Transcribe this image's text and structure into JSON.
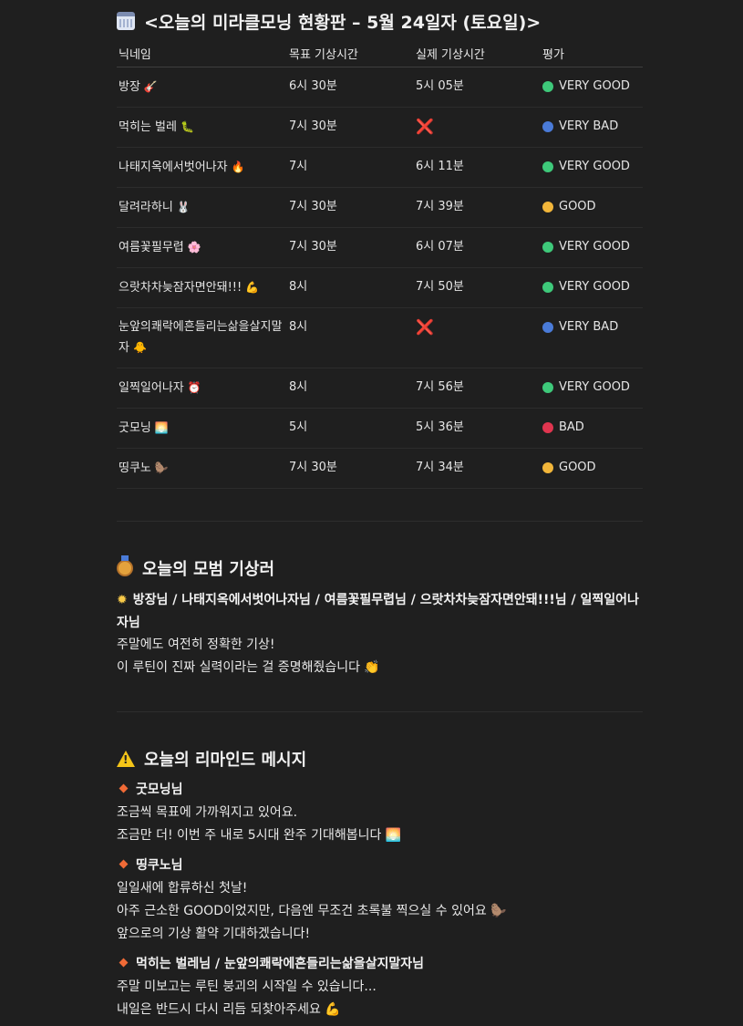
{
  "title": "<오늘의 미라클모닝 현황판 – 5월 24일자 (토요일)>",
  "table": {
    "headers": [
      "닉네임",
      "목표 기상시간",
      "실제 기상시간",
      "평가"
    ],
    "rows": [
      {
        "nick": "방장",
        "emoji": "🎸",
        "goal": "6시 30분",
        "actual": "5시 05분",
        "eval": "VERY GOOD",
        "dot": "#3ec97a"
      },
      {
        "nick": "먹히는 벌레",
        "emoji": "🐛",
        "goal": "7시 30분",
        "actual": "❌",
        "eval": "VERY BAD",
        "dot": "#4a7bd8"
      },
      {
        "nick": "나태지옥에서벗어나자",
        "emoji": "🔥",
        "goal": "7시",
        "actual": "6시 11분",
        "eval": "VERY GOOD",
        "dot": "#3ec97a"
      },
      {
        "nick": "달려라하니",
        "emoji": "🐰",
        "goal": "7시 30분",
        "actual": "7시 39분",
        "eval": "GOOD",
        "dot": "#f2b63a"
      },
      {
        "nick": "여름꽃필무렵",
        "emoji": "🌸",
        "goal": "7시 30분",
        "actual": "6시 07분",
        "eval": "VERY GOOD",
        "dot": "#3ec97a"
      },
      {
        "nick": "으랏차차늦잠자면안돼!!!",
        "emoji": "💪",
        "goal": "8시",
        "actual": "7시 50분",
        "eval": "VERY GOOD",
        "dot": "#3ec97a"
      },
      {
        "nick": "눈앞의쾌락에흔들리는삶을살지말자",
        "emoji": "🐥",
        "goal": "8시",
        "actual": "❌",
        "eval": "VERY BAD",
        "dot": "#4a7bd8"
      },
      {
        "nick": "일찍일어나자",
        "emoji": "⏰",
        "goal": "8시",
        "actual": "7시 56분",
        "eval": "VERY GOOD",
        "dot": "#3ec97a"
      },
      {
        "nick": "굿모닝",
        "emoji": "🌅",
        "goal": "5시",
        "actual": "5시 36분",
        "eval": "BAD",
        "dot": "#e0354f"
      },
      {
        "nick": "띵쿠노",
        "emoji": "🦫",
        "goal": "7시 30분",
        "actual": "7시 34분",
        "eval": "GOOD",
        "dot": "#f2b63a"
      }
    ]
  },
  "model": {
    "heading": "오늘의 모범 기상러",
    "icon": "medal-icon",
    "names": "방장님 / 나태지옥에서벗어나자님 / 여름꽃필무렵님 / 으랏차차늦잠자면안돼!!!님 / 일찍일어나자님",
    "line1": "주말에도 여전히 정확한 기상!",
    "line2": "이 루틴이 진짜 실력이라는 걸 증명해줬습니다 👏"
  },
  "reminder": {
    "heading": "오늘의 리마인드 메시지",
    "icon": "warning-icon",
    "items": [
      {
        "name": "굿모닝님",
        "lines": [
          "조금씩 목표에 가까워지고 있어요.",
          "조금만 더! 이번 주 내로 5시대 완주 기대해봅니다 🌅"
        ]
      },
      {
        "name": "띵쿠노님",
        "lines": [
          "일일새에 합류하신 첫날!",
          "아주 근소한 GOOD이었지만, 다음엔 무조건 초록불 찍으실 수 있어요 🦫",
          "앞으로의 기상 활약 기대하겠습니다!"
        ]
      },
      {
        "name": "먹히는 벌레님 / 눈앞의쾌락에흔들리는삶을살지말자님",
        "lines": [
          "주말 미보고는 루틴 붕괴의 시작일 수 있습니다...",
          "내일은 반드시 다시 리듬 되찾아주세요 💪"
        ]
      }
    ]
  }
}
